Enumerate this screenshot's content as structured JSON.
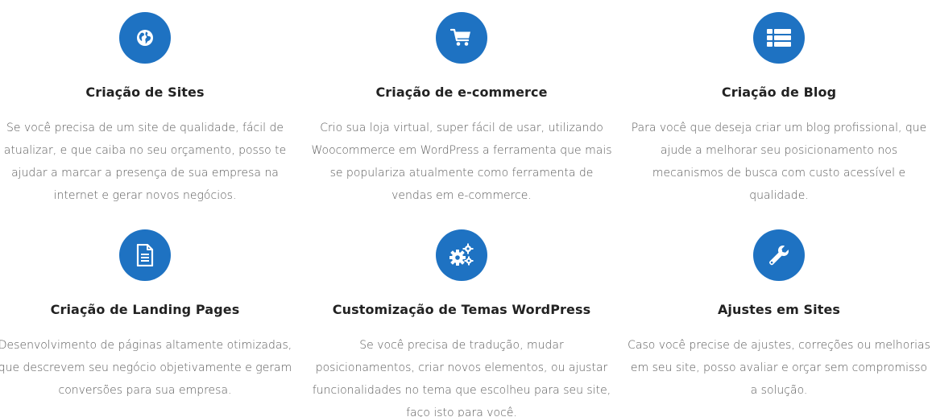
{
  "accent_color": "#1e72c2",
  "services": [
    {
      "icon": "globe-icon",
      "title": "Criação de Sites",
      "lines": [
        "Se você precisa de um site de qualidade, fácil de",
        "atualizar, e que caiba no seu orçamento, posso te",
        "ajudar a marcar a presença de sua empresa na",
        "internet e gerar novos negócios."
      ]
    },
    {
      "icon": "shopping-cart-icon",
      "title": "Criação de e-commerce",
      "lines": [
        "Crio sua loja virtual, super fácil de usar, utilizando",
        "Woocommerce em WordPress a ferramenta que mais",
        "se populariza atualmente como ferramenta de",
        "vendas em e-commerce."
      ]
    },
    {
      "icon": "list-icon",
      "title": "Criação de Blog",
      "lines": [
        "Para você que deseja criar um blog profissional, que",
        "ajude a melhorar seu posicionamento nos",
        "mecanismos de busca com custo acessível e",
        "qualidade."
      ]
    },
    {
      "icon": "document-icon",
      "title": "Criação de Landing Pages",
      "lines": [
        "Desenvolvimento de páginas altamente otimizadas,",
        "que descrevem seu negócio objetivamente e geram",
        "conversões para sua empresa."
      ]
    },
    {
      "icon": "gears-icon",
      "title": "Customização de Temas WordPress",
      "lines": [
        "Se você precisa de tradução, mudar",
        "posicionamentos, criar novos elementos, ou ajustar",
        "funcionalidades no tema que escolheu para seu site,",
        "faço isto para você."
      ]
    },
    {
      "icon": "wrench-icon",
      "title": "Ajustes em Sites",
      "lines": [
        "Caso você precise de ajustes, correções ou melhorias",
        "em seu site, posso avaliar e orçar sem compromisso",
        "a solução."
      ]
    }
  ]
}
